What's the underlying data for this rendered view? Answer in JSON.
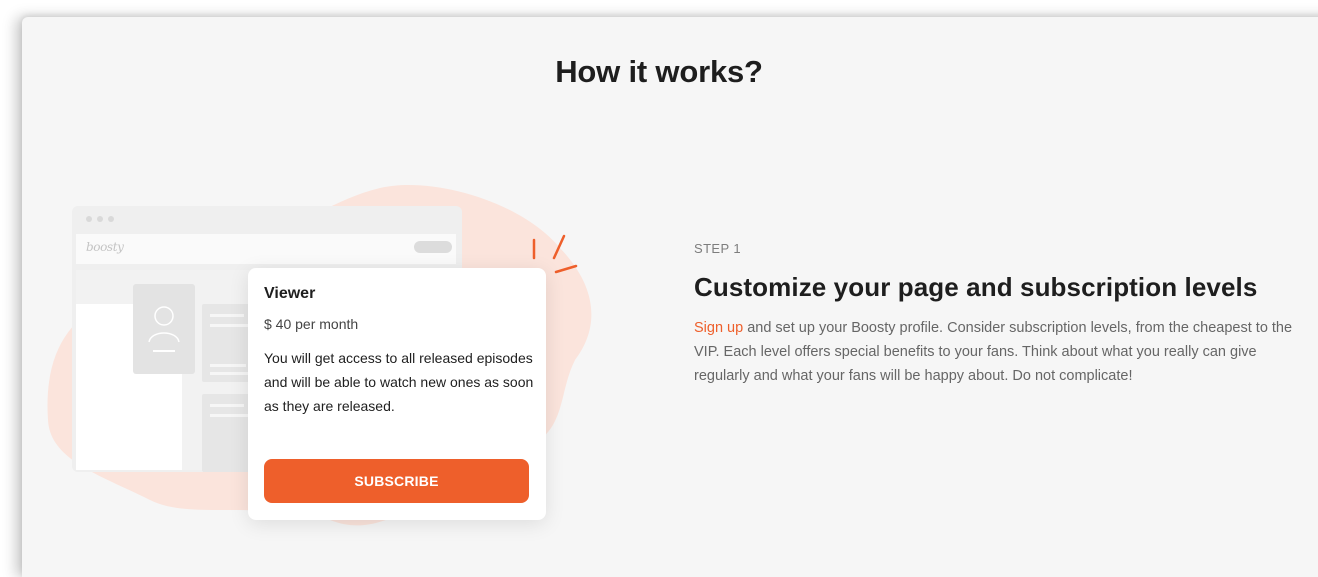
{
  "section": {
    "heading": "How it works?"
  },
  "illustration": {
    "browser_logo": "boosty",
    "card": {
      "title": "Viewer",
      "price": "$ 40 per month",
      "description": "You will get access to all released episodes and will be able to watch new ones as soon as they are released.",
      "button_label": "SUBSCRIBE"
    }
  },
  "step": {
    "label": "STEP 1",
    "title": "Customize your page and subscription levels",
    "link_text": "Sign up",
    "body_text": " and set up your Boosty profile. Consider subscription levels, from the cheapest to the VIP. Each level offers special benefits to your fans. Think about what you really can give regularly and what your fans will be happy about. Do not complicate!"
  },
  "colors": {
    "accent": "#ee5f2b",
    "background": "#f6f6f6",
    "blob": "#fbe4dc"
  }
}
